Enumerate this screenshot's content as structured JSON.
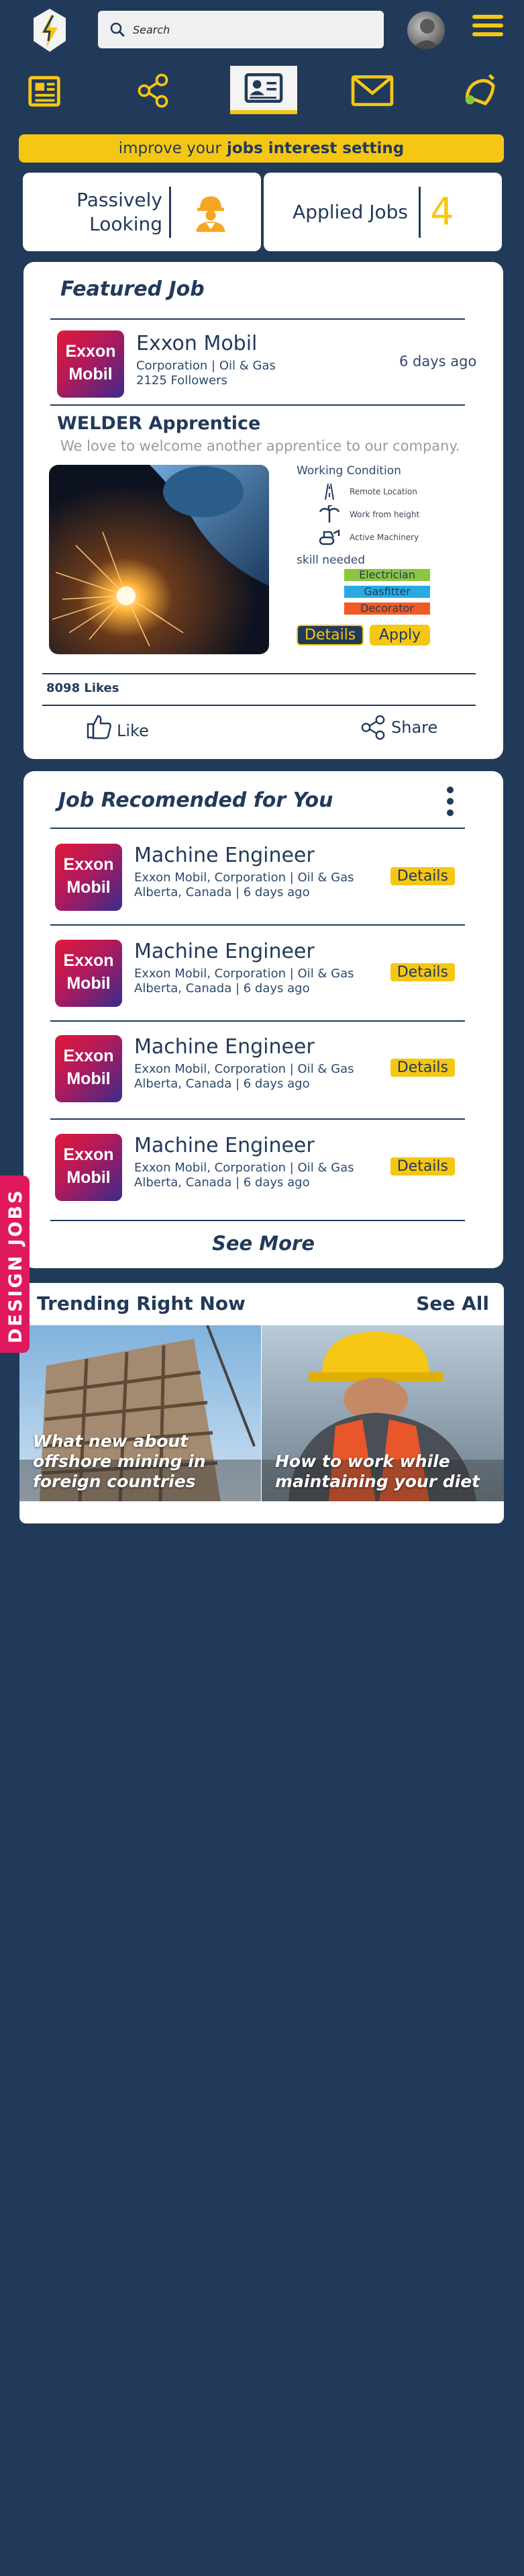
{
  "topbar": {
    "search_placeholder": "Search"
  },
  "nav": {
    "items": [
      "news-icon",
      "share-icon",
      "id-card-icon",
      "mail-icon",
      "bell-icon"
    ],
    "active": "id-card-icon"
  },
  "banner": {
    "text": "improve your",
    "bold": "jobs interest setting"
  },
  "stats": {
    "passive_line1": "Passively",
    "passive_line2": "Looking",
    "applied_label": "Applied Jobs",
    "applied_count": "4"
  },
  "featured": {
    "title": "Featured Job",
    "company": "Exxon Mobil",
    "company_logo_line1": "Exxon",
    "company_logo_line2": "Mobil",
    "category": "Corporation | Oil & Gas",
    "followers": "2125 Followers",
    "posted": "6 days ago",
    "job_title": "WELDER Apprentice",
    "description": "We love to welcome another apprentice to our company.",
    "working_condition_label": "Working Condition",
    "conditions": [
      "Remote Location",
      "Work from height",
      "Active Machinery"
    ],
    "skill_label": "skill needed",
    "skills": [
      "Electrician",
      "Gasfitter",
      "Decorator"
    ],
    "details_btn": "Details",
    "apply_btn": "Apply",
    "likes": "8098 Likes",
    "like_btn": "Like",
    "share_btn": "Share"
  },
  "recommended": {
    "title": "Job Recomended for You",
    "items": [
      {
        "title": "Machine Engineer",
        "company": "Exxon Mobil, Corporation | Oil & Gas",
        "meta": "Alberta, Canada | 6 days ago",
        "btn": "Details"
      },
      {
        "title": "Machine Engineer",
        "company": "Exxon Mobil, Corporation | Oil & Gas",
        "meta": "Alberta, Canada | 6 days ago",
        "btn": "Details"
      },
      {
        "title": "Machine Engineer",
        "company": "Exxon Mobil, Corporation | Oil & Gas",
        "meta": "Alberta, Canada | 6 days ago",
        "btn": "Details"
      },
      {
        "title": "Machine Engineer",
        "company": "Exxon Mobil, Corporation | Oil & Gas",
        "meta": "Alberta, Canada | 6 days ago",
        "btn": "Details"
      }
    ],
    "see_more": "See More"
  },
  "trending": {
    "title": "Trending Right Now",
    "see_all": "See All",
    "cards": [
      {
        "caption": "What new about offshore mining in foreign countries"
      },
      {
        "caption": "How to work while maintaining your diet"
      }
    ]
  },
  "side_tab": {
    "label": "DESIGN JOBS"
  },
  "colors": {
    "background": "#223a5a",
    "accent": "#f5c712",
    "side_tab": "#e0195e",
    "skill_electrician": "#8dc63f",
    "skill_gasfitter": "#29abe2",
    "skill_decorator": "#f15a24"
  }
}
